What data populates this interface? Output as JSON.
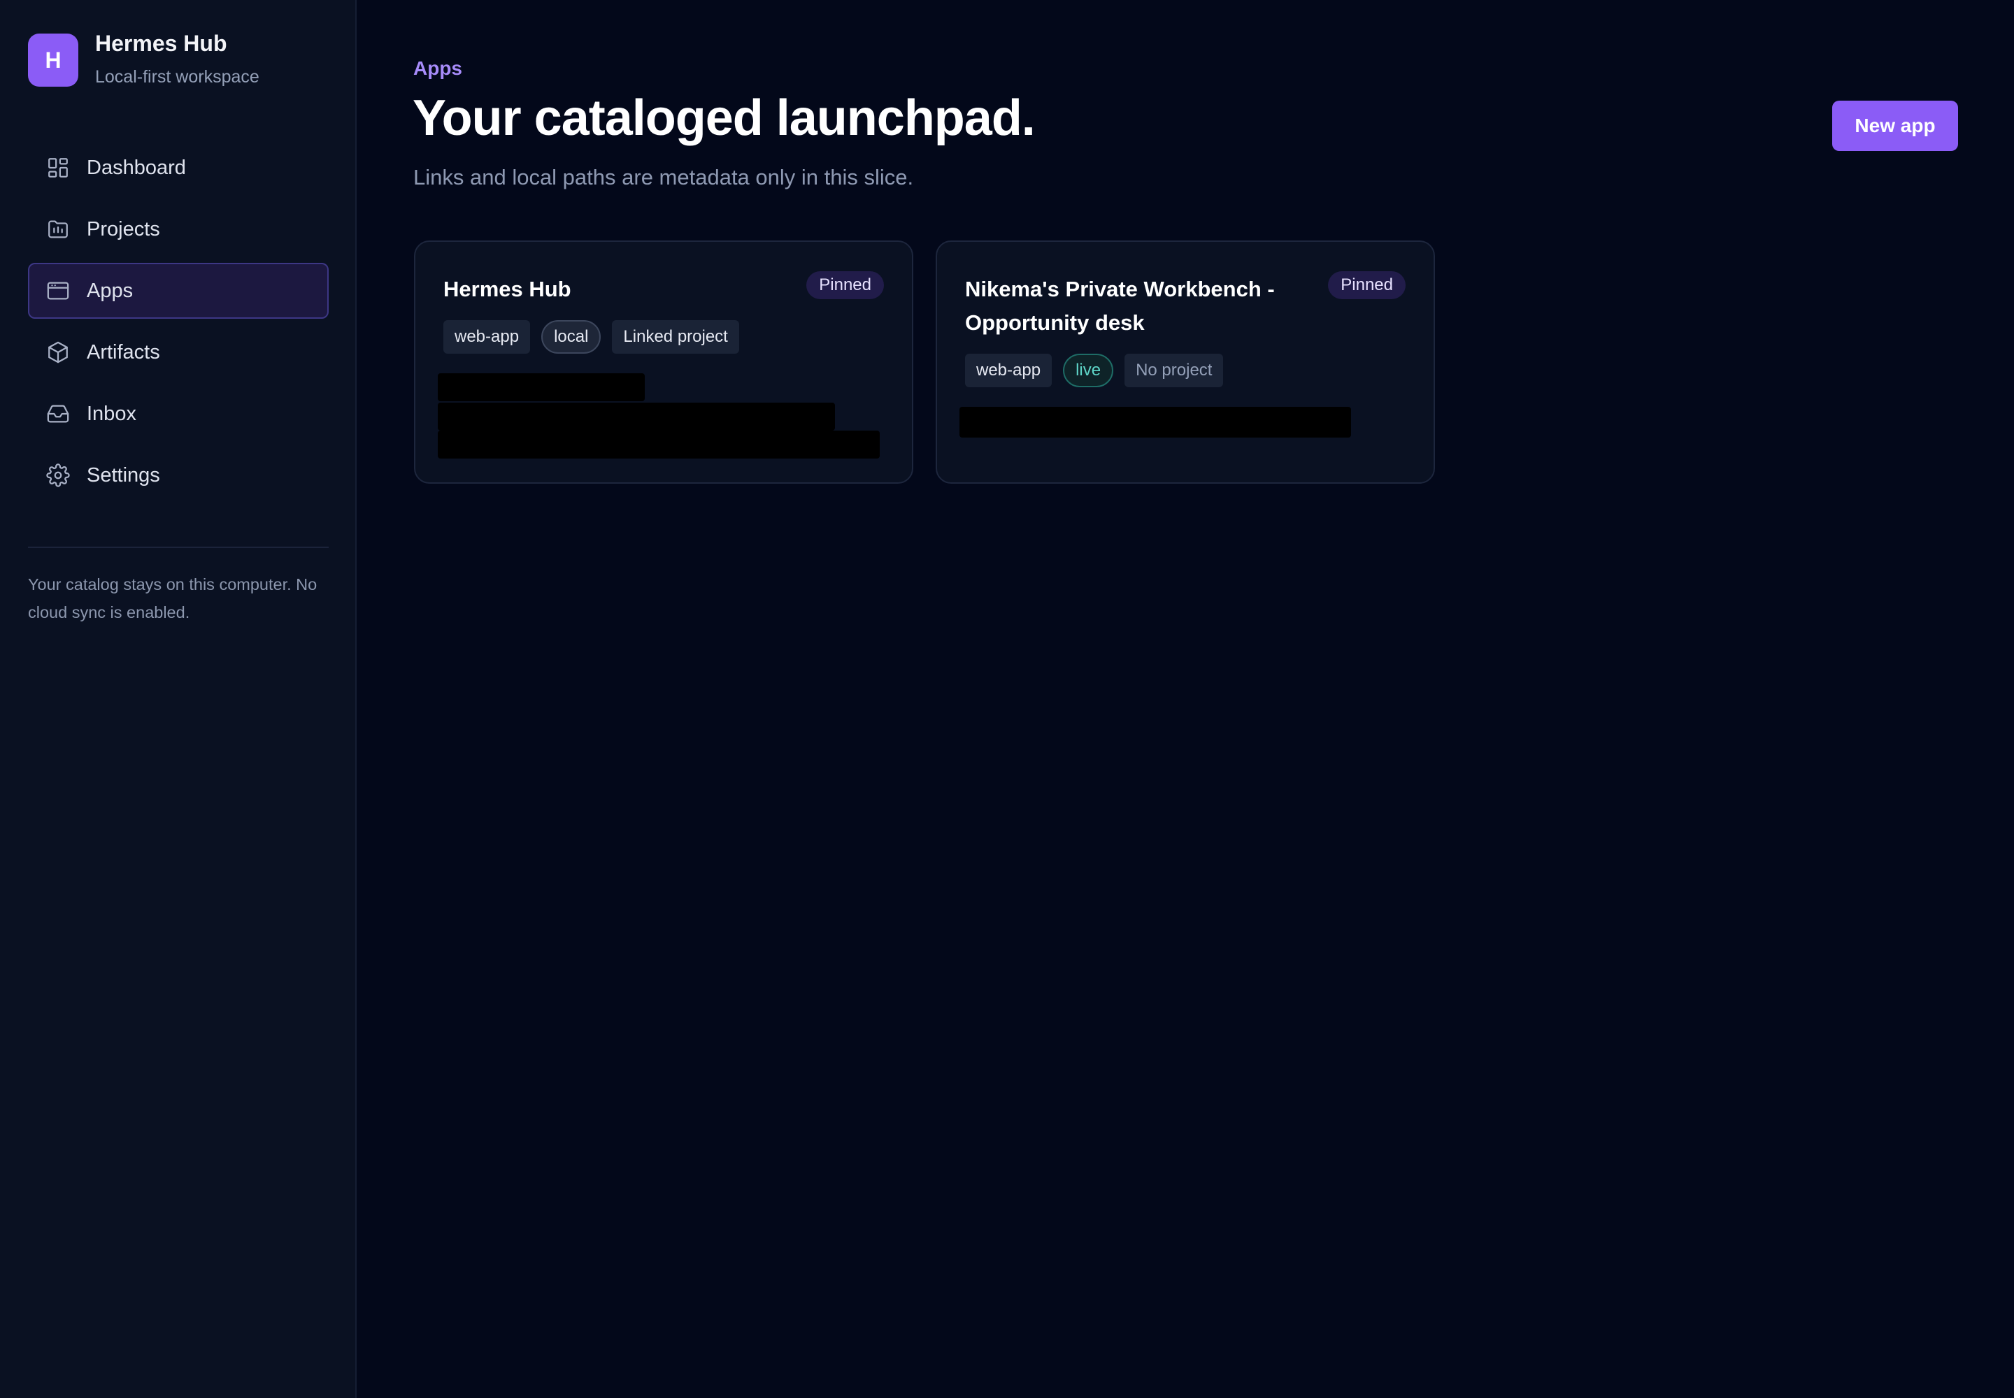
{
  "brand": {
    "initial": "H",
    "name": "Hermes Hub",
    "subtitle": "Local-first workspace"
  },
  "nav": {
    "items": [
      {
        "label": "Dashboard",
        "icon": "dashboard-icon",
        "active": false
      },
      {
        "label": "Projects",
        "icon": "folder-chart-icon",
        "active": false
      },
      {
        "label": "Apps",
        "icon": "app-window-icon",
        "active": true
      },
      {
        "label": "Artifacts",
        "icon": "package-icon",
        "active": false
      },
      {
        "label": "Inbox",
        "icon": "inbox-icon",
        "active": false
      },
      {
        "label": "Settings",
        "icon": "gear-icon",
        "active": false
      }
    ]
  },
  "sidebar_note": "Your catalog stays on this computer. No cloud sync is enabled.",
  "header": {
    "eyebrow": "Apps",
    "title": "Your cataloged launchpad.",
    "subtitle": "Links and local paths are metadata only in this slice.",
    "new_app_label": "New app"
  },
  "apps": [
    {
      "name": "Hermes Hub",
      "badge": "Pinned",
      "tags": [
        "web-app",
        "local",
        "Linked project"
      ]
    },
    {
      "name": "Nikema's Private Workbench - Opportunity desk",
      "badge": "Pinned",
      "tags": [
        "web-app",
        "live",
        "No project"
      ]
    }
  ],
  "colors": {
    "accent": "#8b5cf6",
    "background": "#03081a",
    "sidebar": "#0a1122",
    "live": "#5fd6c9"
  }
}
